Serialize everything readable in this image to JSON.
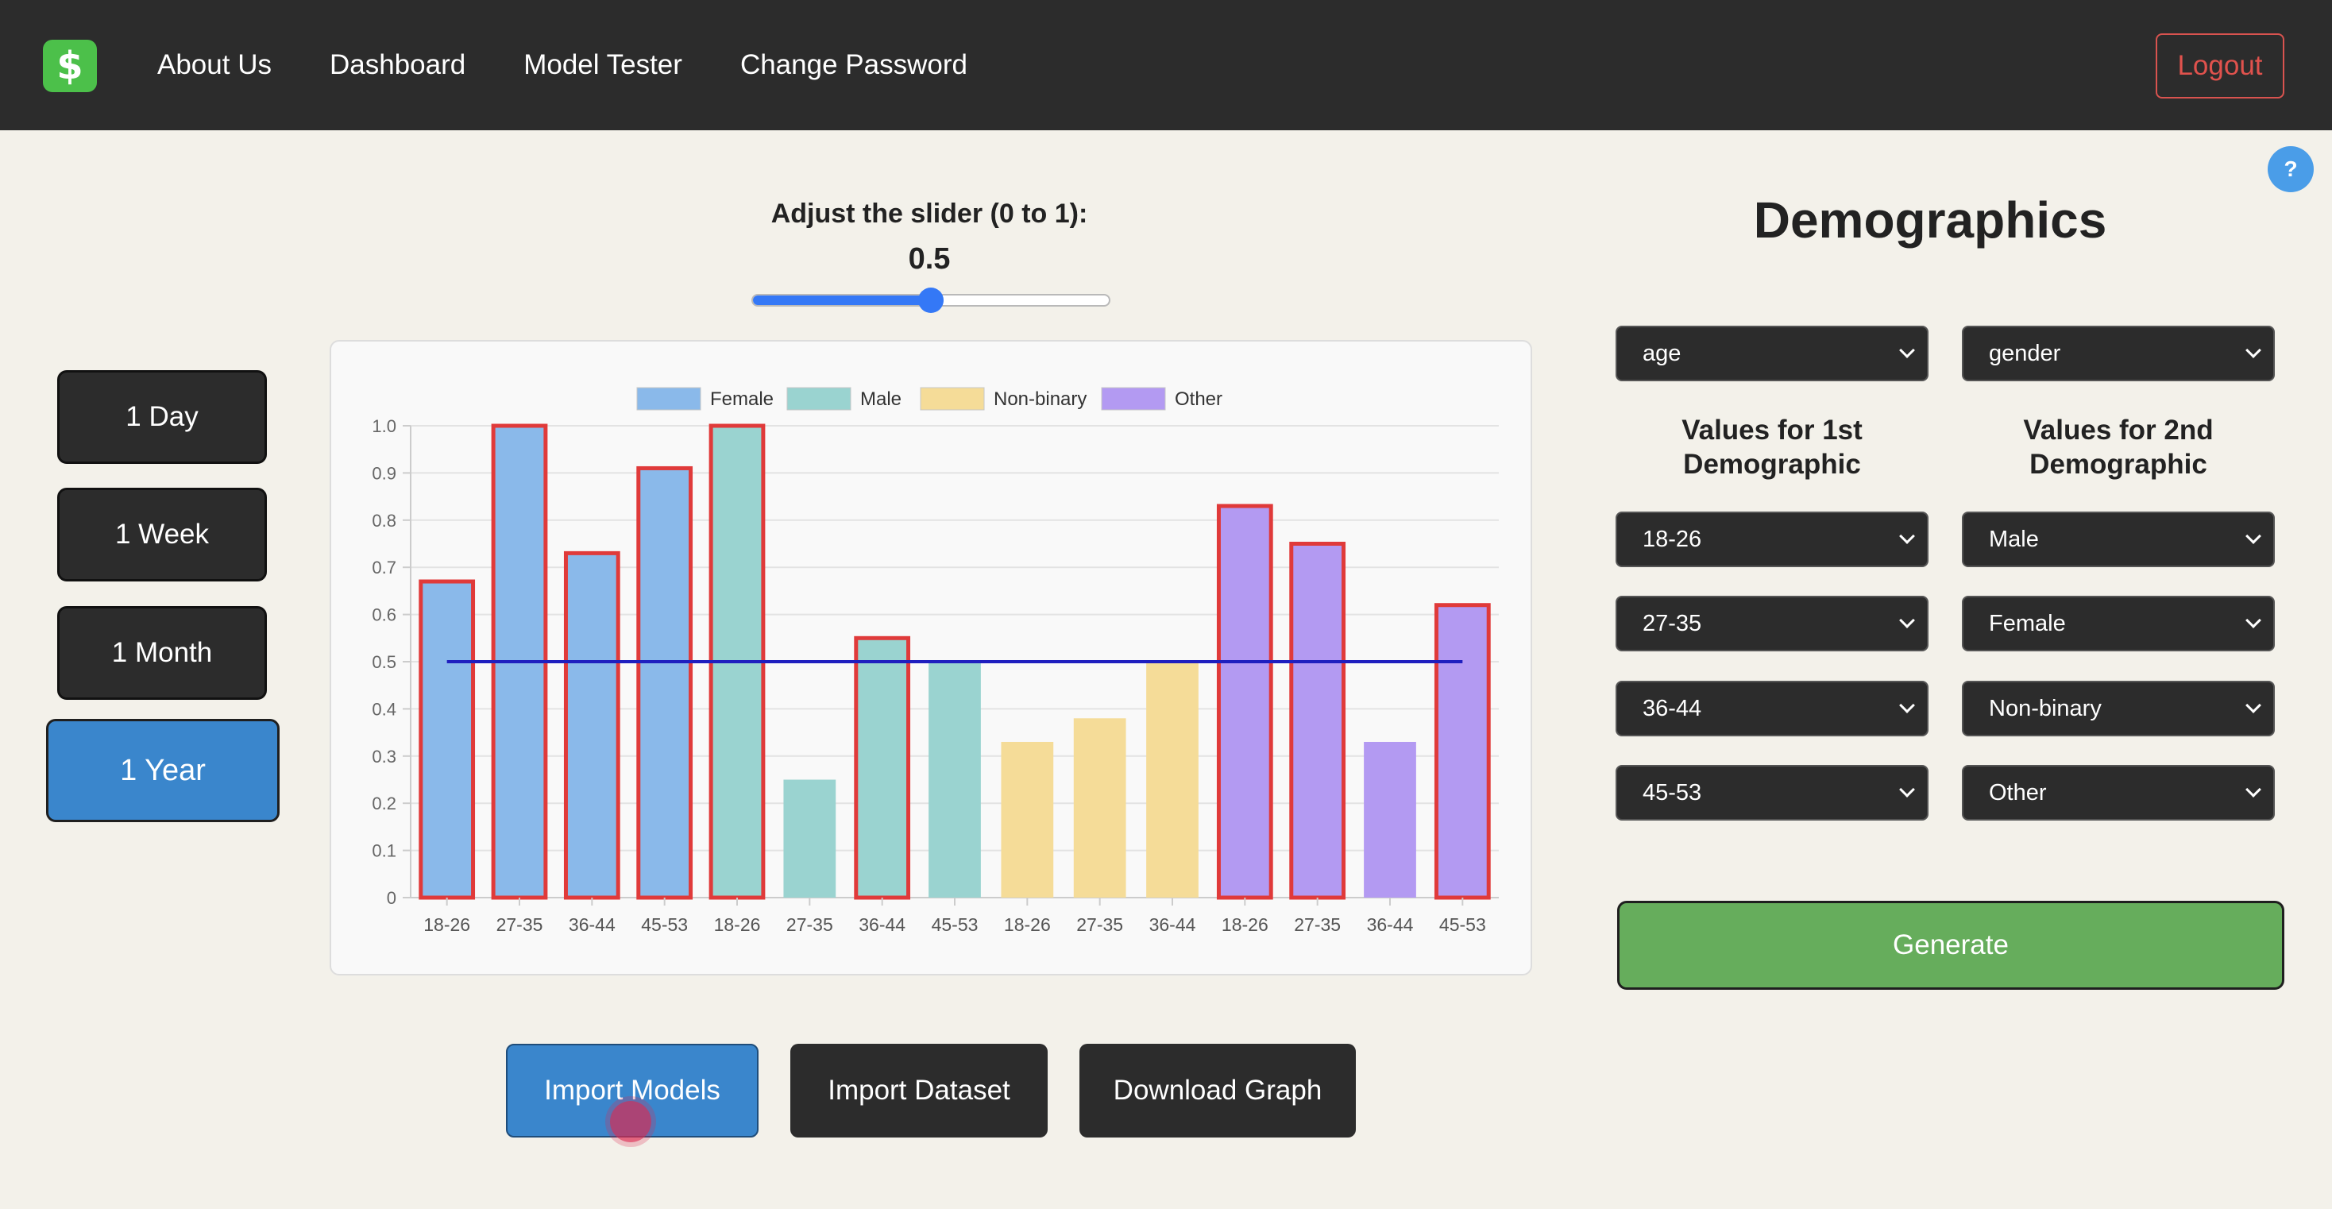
{
  "nav": {
    "logo_symbol": "$",
    "links": [
      "About Us",
      "Dashboard",
      "Model Tester",
      "Change Password"
    ],
    "logout": "Logout"
  },
  "help": "?",
  "ranges": [
    "1 Day",
    "1 Week",
    "1 Month",
    "1 Year"
  ],
  "active_range": "1 Year",
  "slider": {
    "label": "Adjust the slider (0 to 1):",
    "value_text": "0.5",
    "value": 0.5,
    "min": 0,
    "max": 1
  },
  "buttons": {
    "import_models": "Import Models",
    "import_dataset": "Import Dataset",
    "download_graph": "Download Graph",
    "generate": "Generate"
  },
  "demographics": {
    "title": "Demographics",
    "first_select": "age",
    "second_select": "gender",
    "first_header": [
      "Values for 1st",
      "Demographic"
    ],
    "second_header": [
      "Values for 2nd",
      "Demographic"
    ],
    "first_values": [
      "18-26",
      "27-35",
      "36-44",
      "45-53"
    ],
    "second_values": [
      "Male",
      "Female",
      "Non-binary",
      "Other"
    ]
  },
  "chart_data": {
    "type": "bar",
    "categories": [
      "18-26",
      "27-35",
      "36-44",
      "45-53",
      "18-26",
      "27-35",
      "36-44",
      "45-53",
      "18-26",
      "27-35",
      "36-44",
      "45-53",
      "18-26",
      "27-35",
      "36-44",
      "45-53"
    ],
    "series": [
      {
        "name": "Female",
        "color": "#8ab9ea",
        "values": [
          0.67,
          1.0,
          0.73,
          0.91,
          null,
          null,
          null,
          null,
          null,
          null,
          null,
          null,
          null,
          null,
          null,
          null
        ]
      },
      {
        "name": "Male",
        "color": "#9ad3d0",
        "values": [
          null,
          null,
          null,
          null,
          1.0,
          0.25,
          0.55,
          0.5,
          null,
          null,
          null,
          null,
          null,
          null,
          null,
          null
        ]
      },
      {
        "name": "Non-binary",
        "color": "#f5dc98",
        "values": [
          null,
          null,
          null,
          null,
          null,
          null,
          null,
          null,
          0.33,
          0.38,
          0.5,
          null,
          null,
          null,
          null,
          null
        ]
      },
      {
        "name": "Other",
        "color": "#b39af2",
        "values": [
          null,
          null,
          null,
          null,
          null,
          null,
          null,
          null,
          null,
          null,
          null,
          0.83,
          0.75,
          0.33,
          0.62,
          null
        ]
      }
    ],
    "bar_values": [
      0.67,
      1.0,
      0.73,
      0.91,
      1.0,
      0.25,
      0.55,
      0.5,
      0.33,
      0.38,
      0.5,
      0.83,
      0.75,
      0.33,
      0.62
    ],
    "bar_series": [
      "Female",
      "Female",
      "Female",
      "Female",
      "Male",
      "Male",
      "Male",
      "Male",
      "Non-binary",
      "Non-binary",
      "Non-binary",
      "Other",
      "Other",
      "Other",
      "Other"
    ],
    "threshold": 0.5,
    "threshold_color": "#1f1fbf",
    "highlight_color": "#e03a3a",
    "ylim": [
      0,
      1.0
    ],
    "yticks": [
      0,
      0.1,
      0.2,
      0.3,
      0.4,
      0.5,
      0.6,
      0.7,
      0.8,
      0.9,
      1.0
    ],
    "ytick_labels": [
      "0",
      "0.1",
      "0.2",
      "0.3",
      "0.4",
      "0.5",
      "0.6",
      "0.7",
      "0.8",
      "0.9",
      "1.0"
    ],
    "xtick_labels": [
      "18-26",
      "27-35",
      "36-44",
      "45-53",
      "18-26",
      "27-35",
      "36-44",
      "45-53",
      "18-26",
      "27-35",
      "36-44",
      "18-26",
      "27-35",
      "36-44",
      "45-53"
    ],
    "legend": [
      "Female",
      "Male",
      "Non-binary",
      "Other"
    ],
    "legend_position": "top",
    "grid": true
  }
}
